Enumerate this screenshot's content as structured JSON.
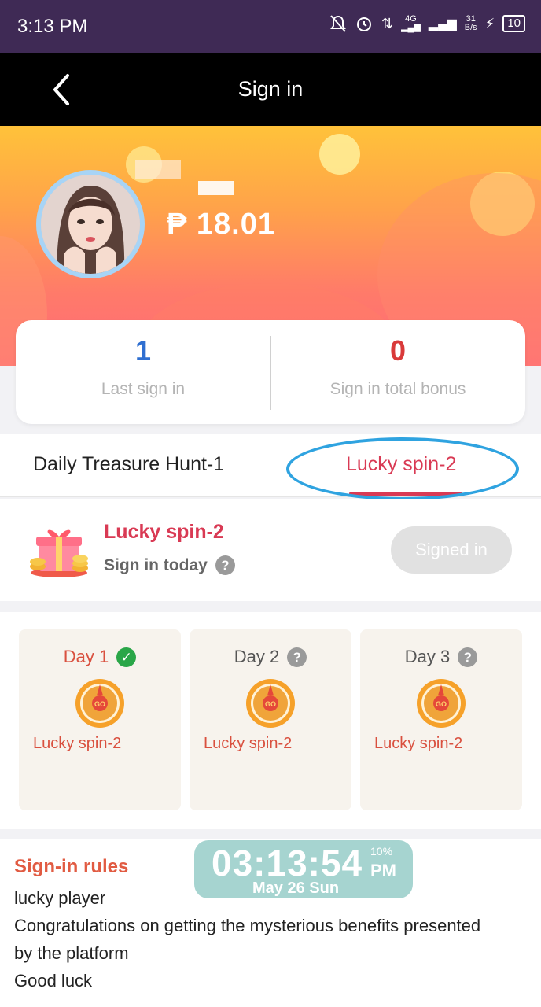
{
  "status_bar": {
    "time": "3:13 PM",
    "network": "4G",
    "speed_value": "31",
    "speed_unit": "B/s",
    "battery": "10"
  },
  "nav": {
    "title": "Sign in",
    "back_icon": "chevron-left-icon"
  },
  "profile": {
    "balance": "₱ 18.01"
  },
  "stats": {
    "last_sign_in_value": "1",
    "last_sign_in_label": "Last sign in",
    "total_bonus_value": "0",
    "total_bonus_label": "Sign in total bonus"
  },
  "tabs": [
    {
      "label": "Daily Treasure Hunt-1"
    },
    {
      "label": "Lucky spin-2"
    }
  ],
  "today": {
    "title": "Lucky spin-2",
    "subtitle": "Sign in today",
    "button_label": "Signed in"
  },
  "days": [
    {
      "label": "Day 1",
      "reward": "Lucky spin-2",
      "status": "signed"
    },
    {
      "label": "Day 2",
      "reward": "Lucky spin-2",
      "status": "unknown"
    },
    {
      "label": "Day 3",
      "reward": "Lucky spin-2",
      "status": "unknown"
    }
  ],
  "rules": {
    "title": "Sign-in rules",
    "lines": [
      "lucky player",
      "Congratulations on getting the mysterious benefits presented",
      "by the platform",
      "Good luck"
    ]
  },
  "clock_widget": {
    "time": "03:13:54",
    "ampm": "PM",
    "percent": "10%",
    "date": "May 26 Sun"
  },
  "colors": {
    "accent": "#d93a54",
    "status_bar": "#3f2a55",
    "annotation_circle": "#2fa3e0"
  }
}
